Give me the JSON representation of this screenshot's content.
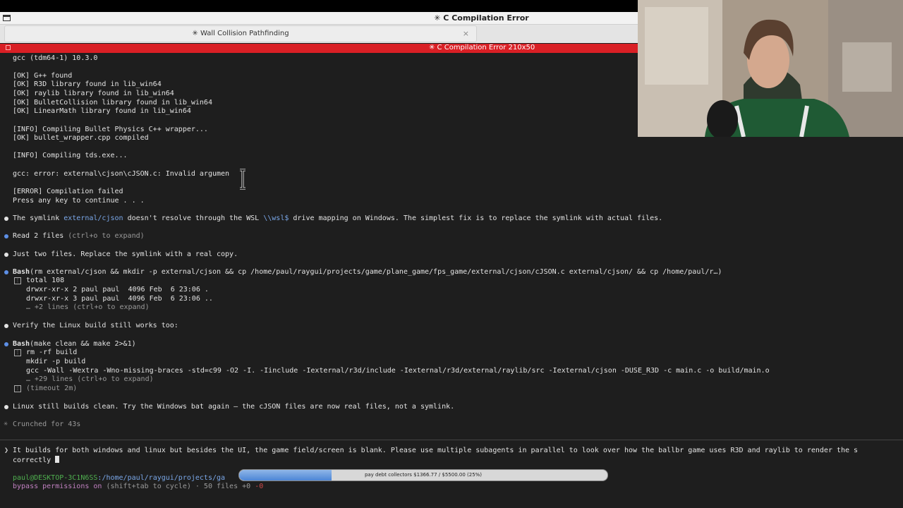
{
  "window": {
    "title": "✳ C Compilation Error",
    "tab_label": "✳ Wall Collision Pathfinding",
    "tab_close": "×",
    "pane_title": "✳ C Compilation Error 210x50"
  },
  "build_output": [
    "gcc (tdm64-1) 10.3.0",
    "[OK] G++ found",
    "[OK] R3D library found in lib_win64",
    "[OK] raylib library found in lib_win64",
    "[OK] BulletCollision library found in lib_win64",
    "[OK] LinearMath library found in lib_win64",
    "[INFO] Compiling Bullet Physics C++ wrapper...",
    "[OK] bullet_wrapper.cpp compiled",
    "[INFO] Compiling tds.exe...",
    "gcc: error: external\\cjson\\cJSON.c: Invalid argumen",
    "[ERROR] Compilation failed",
    "Press any key to continue . . ."
  ],
  "conversation": {
    "msg1_pre": "The symlink ",
    "msg1_path": "external/cjson",
    "msg1_mid": " doesn't resolve through the WSL ",
    "msg1_path2": "\\\\wsl$",
    "msg1_post": " drive mapping on Windows. The simplest fix is to replace the symlink with actual files.",
    "read_label": "Read 2 files",
    "read_hint": " (ctrl+o to expand)",
    "msg2": "Just two files. Replace the symlink with a real copy.",
    "bash1_tool": "Bash",
    "bash1_cmd": "(rm external/cjson && mkdir -p external/cjson && cp /home/paul/raygui/projects/game/plane_game/fps_game/external/cjson/cJSON.c external/cjson/ && cp /home/paul/r…)",
    "bash1_out1": "total 108",
    "bash1_out2": "drwxr-xr-x 2 paul paul  4096 Feb  6 23:06 .",
    "bash1_out3": "drwxr-xr-x 3 paul paul  4096 Feb  6 23:06 ..",
    "bash1_more": "… +2 lines (ctrl+o to expand)",
    "msg3": "Verify the Linux build still works too:",
    "bash2_tool": "Bash",
    "bash2_cmd": "(make clean && make 2>&1)",
    "bash2_out1": "rm -rf build",
    "bash2_out2": "mkdir -p build",
    "bash2_out3": "gcc -Wall -Wextra -Wno-missing-braces -std=c99 -O2 -I. -Iinclude -Iexternal/r3d/include -Iexternal/r3d/external/raylib/src -Iexternal/cjson -DUSE_R3D -c main.c -o build/main.o",
    "bash2_more": "… +29 lines (ctrl+o to expand)",
    "bash2_timeout": "(timeout 2m)",
    "msg4": "Linux still builds clean. Try the Windows bat again — the cJSON files are now real files, not a symlink.",
    "crunched": "Crunched for 43s"
  },
  "prompt": {
    "arrow": "❯",
    "line1": "It builds for both windows and linux but besides the UI, the game field/screen is blank. Please use multiple subagents in parallel to look over how the ballbr game uses R3D and raylib to render the s",
    "line2": "correctly "
  },
  "status": {
    "host": "paul@DESKTOP-3C1N6SS",
    "path": ":/home/paul/raygui/projects/ga",
    "perm": "bypass permissions on",
    "perm_hint": " (shift+tab to cycle) · 50 files ",
    "plus": "+0",
    "minus": " -0"
  },
  "overlay_progress": {
    "label": "pay debt collectors $1366.77 / $5500.00 (25%)",
    "fraction": 0.25
  },
  "colors": {
    "accent_red": "#d91f25",
    "path_blue": "#7aa7e8",
    "bullet_blue": "#5d8fe6"
  }
}
